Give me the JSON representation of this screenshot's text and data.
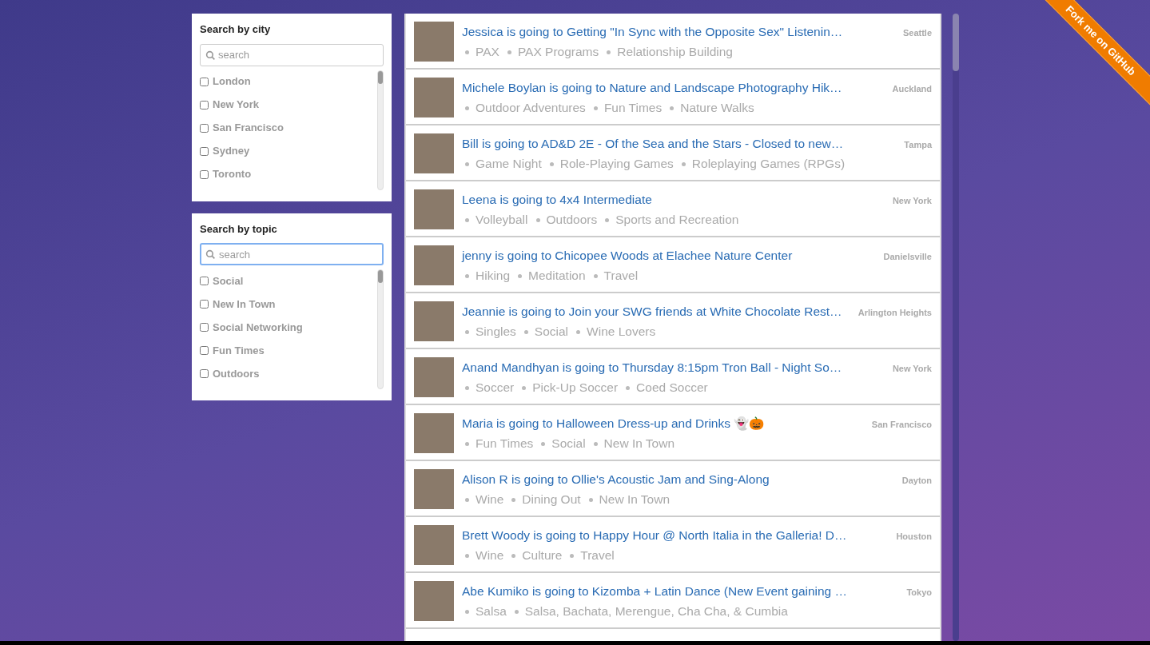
{
  "filters": [
    {
      "title": "Search by city",
      "search": {
        "placeholder": "search",
        "focused": false
      },
      "options": [
        {
          "label": "London",
          "checked": false
        },
        {
          "label": "New York",
          "checked": false
        },
        {
          "label": "San Francisco",
          "checked": false
        },
        {
          "label": "Sydney",
          "checked": false
        },
        {
          "label": "Toronto",
          "checked": false
        }
      ]
    },
    {
      "title": "Search by topic",
      "search": {
        "placeholder": "search",
        "focused": true
      },
      "options": [
        {
          "label": "Social",
          "checked": false
        },
        {
          "label": "New In Town",
          "checked": false
        },
        {
          "label": "Social Networking",
          "checked": false
        },
        {
          "label": "Fun Times",
          "checked": false
        },
        {
          "label": "Outdoors",
          "checked": false
        }
      ]
    }
  ],
  "feed": [
    {
      "title": "Jessica is going to Getting \"In Sync with the Opposite Sex\" Listenin…",
      "city": "Seattle",
      "topics": [
        "PAX",
        "PAX Programs",
        "Relationship Building"
      ]
    },
    {
      "title": "Michele Boylan is going to Nature and Landscape Photography Hik…",
      "city": "Auckland",
      "topics": [
        "Outdoor Adventures",
        "Fun Times",
        "Nature Walks"
      ]
    },
    {
      "title": "Bill is going to AD&D 2E - Of the Sea and the Stars - Closed to new…",
      "city": "Tampa",
      "topics": [
        "Game Night",
        "Role-Playing Games",
        "Roleplaying Games (RPGs)"
      ]
    },
    {
      "title": "Leena is going to 4x4 Intermediate",
      "city": "New York",
      "topics": [
        "Volleyball",
        "Outdoors",
        "Sports and Recreation"
      ]
    },
    {
      "title": "jenny is going to Chicopee Woods at Elachee Nature Center",
      "city": "Danielsville",
      "topics": [
        "Hiking",
        "Meditation",
        "Travel"
      ]
    },
    {
      "title": "Jeannie is going to Join your SWG friends at White Chocolate Rest…",
      "city": "Arlington Heights",
      "topics": [
        "Singles",
        "Social",
        "Wine Lovers"
      ]
    },
    {
      "title": "Anand Mandhyan is going to Thursday 8:15pm Tron Ball - Night So…",
      "city": "New York",
      "topics": [
        "Soccer",
        "Pick-Up Soccer",
        "Coed Soccer"
      ]
    },
    {
      "title": "Maria is going to Halloween Dress-up and Drinks 👻🎃",
      "city": "San Francisco",
      "topics": [
        "Fun Times",
        "Social",
        "New In Town"
      ]
    },
    {
      "title": "Alison R is going to Ollie's Acoustic Jam and Sing-Along",
      "city": "Dayton",
      "topics": [
        "Wine",
        "Dining Out",
        "New In Town"
      ]
    },
    {
      "title": "Brett Woody is going to Happy Hour @ North Italia in the Galleria! D…",
      "city": "Houston",
      "topics": [
        "Wine",
        "Culture",
        "Travel"
      ]
    },
    {
      "title": "Abe Kumiko is going to Kizomba + Latin Dance (New Event gaining …",
      "city": "Tokyo",
      "topics": [
        "Salsa",
        "Salsa, Bachata, Merengue, Cha Cha, & Cumbia"
      ]
    }
  ],
  "ribbon": {
    "label": "Fork me on GitHub"
  }
}
